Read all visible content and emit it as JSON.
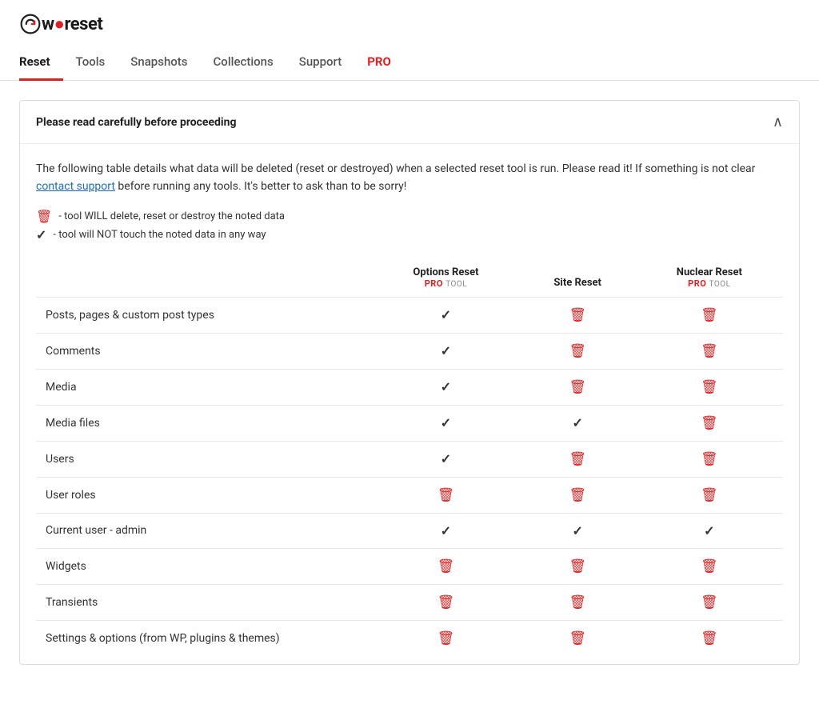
{
  "app": {
    "name": "wpreset",
    "logo_prefix": "w",
    "logo_suffix": "reset"
  },
  "nav": {
    "tabs": [
      {
        "label": "Reset",
        "active": true,
        "pro": false
      },
      {
        "label": "Tools",
        "active": false,
        "pro": false
      },
      {
        "label": "Snapshots",
        "active": false,
        "pro": false
      },
      {
        "label": "Collections",
        "active": false,
        "pro": false
      },
      {
        "label": "Support",
        "active": false,
        "pro": false
      },
      {
        "label": "PRO",
        "active": false,
        "pro": true
      }
    ]
  },
  "card": {
    "header_title": "Please read carefully before proceeding",
    "intro": "The following table details what data will be deleted (reset or destroyed) when a selected reset tool is run. Please read it! If something is not clear ",
    "contact_link_text": "contact support",
    "intro_after": " before running any tools. It's better to ask than to be sorry!",
    "legend_delete": "- tool WILL delete, reset or destroy the noted data",
    "legend_keep": "- tool will NOT touch the noted data in any way",
    "columns": [
      {
        "label": "",
        "sublabel": ""
      },
      {
        "label": "Options Reset",
        "sublabel": "PRO TOOL"
      },
      {
        "label": "Site Reset",
        "sublabel": ""
      },
      {
        "label": "Nuclear Reset",
        "sublabel": "PRO TOOL"
      }
    ],
    "rows": [
      {
        "label": "Posts, pages & custom post types",
        "options_reset": "check",
        "site_reset": "trash",
        "nuclear_reset": "trash"
      },
      {
        "label": "Comments",
        "options_reset": "check",
        "site_reset": "trash",
        "nuclear_reset": "trash"
      },
      {
        "label": "Media",
        "options_reset": "check",
        "site_reset": "trash",
        "nuclear_reset": "trash"
      },
      {
        "label": "Media files",
        "options_reset": "check",
        "site_reset": "check",
        "nuclear_reset": "trash"
      },
      {
        "label": "Users",
        "options_reset": "check",
        "site_reset": "trash",
        "nuclear_reset": "trash"
      },
      {
        "label": "User roles",
        "options_reset": "trash",
        "site_reset": "trash",
        "nuclear_reset": "trash"
      },
      {
        "label": "Current user - admin",
        "options_reset": "check",
        "site_reset": "check",
        "nuclear_reset": "check"
      },
      {
        "label": "Widgets",
        "options_reset": "trash",
        "site_reset": "trash",
        "nuclear_reset": "trash"
      },
      {
        "label": "Transients",
        "options_reset": "trash",
        "site_reset": "trash",
        "nuclear_reset": "trash"
      },
      {
        "label": "Settings & options (from WP, plugins & themes)",
        "options_reset": "trash",
        "site_reset": "trash",
        "nuclear_reset": "trash"
      }
    ]
  },
  "icons": {
    "trash": "🗑",
    "check": "✓",
    "chevron_up": "∧"
  },
  "colors": {
    "accent": "#e02020",
    "link": "#1a6fb5"
  }
}
